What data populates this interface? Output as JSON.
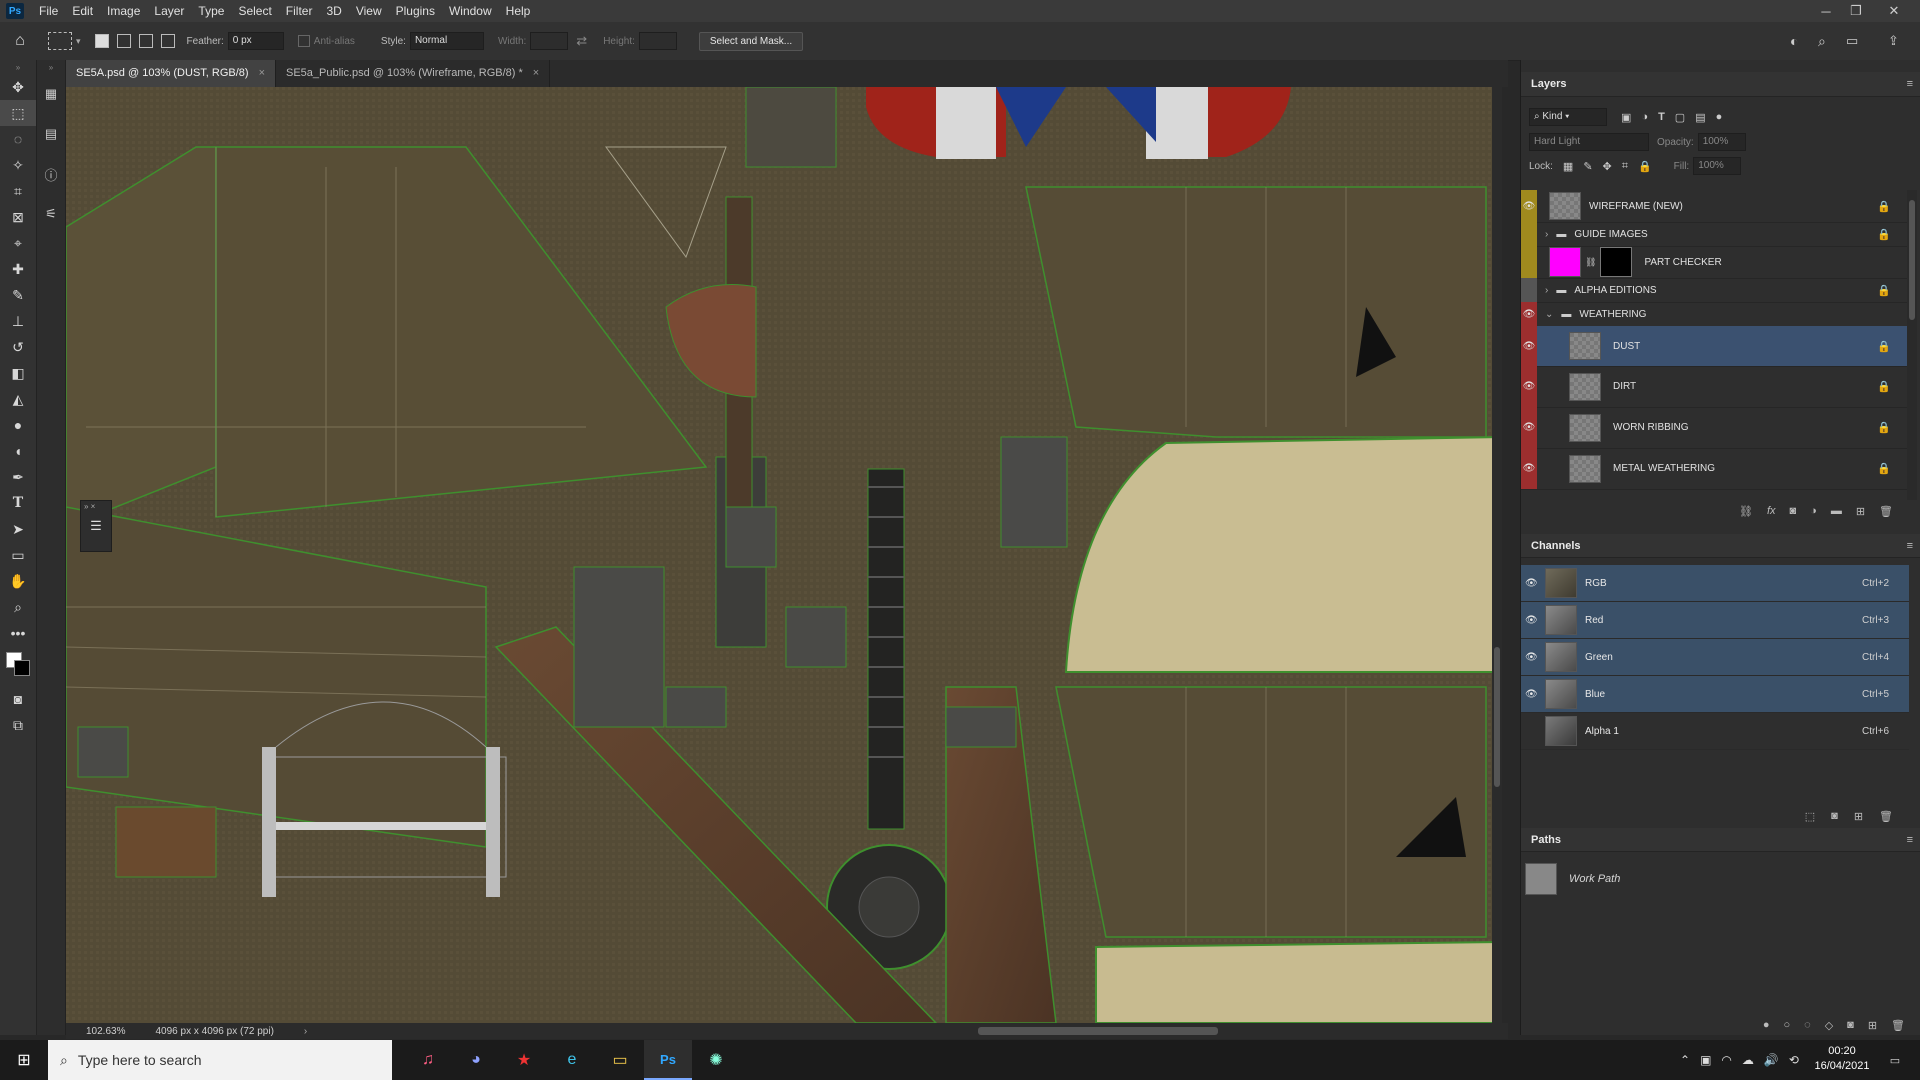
{
  "menubar": {
    "logo": "Ps",
    "items": [
      "File",
      "Edit",
      "Image",
      "Layer",
      "Type",
      "Select",
      "Filter",
      "3D",
      "View",
      "Plugins",
      "Window",
      "Help"
    ]
  },
  "options": {
    "feather_label": "Feather:",
    "feather_value": "0 px",
    "antialias_label": "Anti-alias",
    "style_label": "Style:",
    "style_value": "Normal",
    "width_label": "Width:",
    "height_label": "Height:",
    "select_mask_label": "Select and Mask..."
  },
  "tabs": [
    {
      "label": "SE5A.psd @ 103% (DUST, RGB/8)",
      "close": "×"
    },
    {
      "label": "SE5a_Public.psd @ 103% (Wireframe, RGB/8) *",
      "close": "×"
    }
  ],
  "status": {
    "zoom": "102.63%",
    "doc_size": "4096 px x 4096 px (72 ppi)"
  },
  "layers_panel": {
    "title": "Layers",
    "kind_filter": "Kind",
    "blend_mode": "Hard Light",
    "opacity_label": "Opacity:",
    "opacity_value": "100%",
    "lock_label": "Lock:",
    "fill_label": "Fill:",
    "fill_value": "100%",
    "layers": [
      {
        "name": "WIREFRAME (NEW)",
        "color": "#a08a1e"
      },
      {
        "name": "GUIDE IMAGES",
        "color": "#a08a1e"
      },
      {
        "name": "PART CHECKER",
        "color": "#a08a1e"
      },
      {
        "name": "ALPHA EDITIONS",
        "color": "#555555"
      },
      {
        "name": "WEATHERING",
        "color": "#9c2e2e"
      },
      {
        "name": "DUST",
        "color": "#9c2e2e"
      },
      {
        "name": "DIRT",
        "color": "#9c2e2e"
      },
      {
        "name": "WORN RIBBING",
        "color": "#9c2e2e"
      },
      {
        "name": "METAL WEATHERING",
        "color": "#9c2e2e"
      }
    ]
  },
  "channels_panel": {
    "title": "Channels",
    "channels": [
      {
        "name": "RGB",
        "shortcut": "Ctrl+2"
      },
      {
        "name": "Red",
        "shortcut": "Ctrl+3"
      },
      {
        "name": "Green",
        "shortcut": "Ctrl+4"
      },
      {
        "name": "Blue",
        "shortcut": "Ctrl+5"
      },
      {
        "name": "Alpha 1",
        "shortcut": "Ctrl+6"
      }
    ]
  },
  "paths_panel": {
    "title": "Paths",
    "paths": [
      {
        "name": "Work Path"
      }
    ]
  },
  "taskbar": {
    "search_placeholder": "Type here to search",
    "time": "00:20",
    "date": "16/04/2021"
  },
  "colors": {
    "canvas_bg": "#554c37",
    "wire": "#3f8f2e",
    "fabric_light": "#c9bd92",
    "roundel_red": "#a0231a",
    "roundel_blue": "#1d3a8a",
    "selected_layer": "#3b5170"
  }
}
